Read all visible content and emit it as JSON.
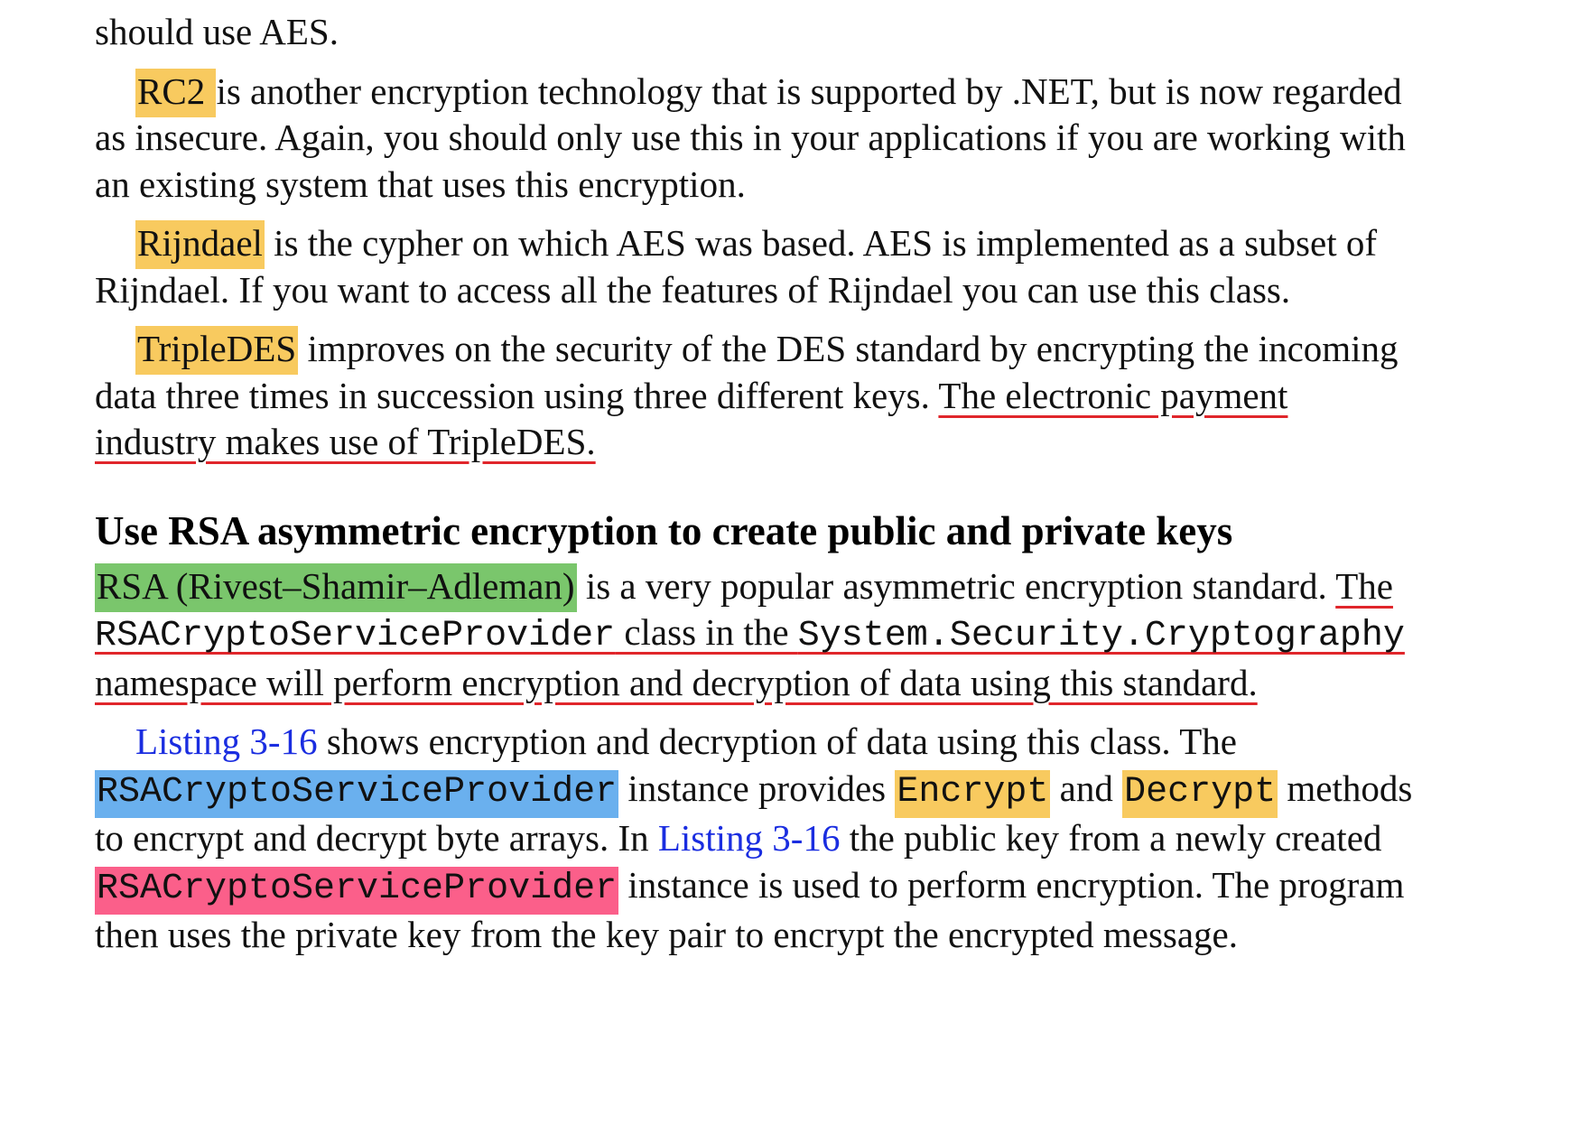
{
  "document": {
    "intro_fragment": "should use AES.",
    "paragraphs": {
      "rc2": {
        "term": "RC2 ",
        "text": "is another encryption technology that is supported by .NET, but is now regarded as insecure. Again, you should only use this in your applications if you are working with an existing system that uses this encryption."
      },
      "rijndael": {
        "term": "Rijndael",
        "text": " is the cypher on which AES was based. AES is implemented as a subset of Rijndael. If you want to access all the features of Rijndael you can use this class."
      },
      "tripledes": {
        "term": "TripleDES",
        "text_plain": " improves on the security of the DES standard by encrypting the incoming data three times in succession using three different keys. ",
        "text_underlined": "The electronic payment industry makes use of TripleDES."
      }
    },
    "section": {
      "heading": "Use RSA asymmetric encryption to create public and private keys",
      "rsa_para": {
        "term": "RSA (Rivest–Shamir–Adleman)",
        "text_plain": " is a very popular asymmetric encryption standard. ",
        "ul_text_1": "The ",
        "ul_code_1": "RSACryptoServiceProvider",
        "ul_text_2": " class in the ",
        "ul_code_2": "System.Security.Cryptography",
        "ul_text_3": " namespace will perform encryption and decryption of data using this standard."
      },
      "listing_para": {
        "link_1": "Listing 3-16",
        "text_1": " shows encryption and decryption of data using this class. The ",
        "code_blue": "RSACryptoServiceProvider",
        "text_2": " instance provides ",
        "code_encrypt": "Encrypt",
        "text_3": " and ",
        "code_decrypt": "Decrypt",
        "text_4": " methods to encrypt and decrypt byte arrays. In ",
        "link_2": "Listing 3-16",
        "text_5": " the public key from a newly created ",
        "code_pink": "RSACryptoServiceProvider",
        "text_6": " instance is used to perform encryption. The program then uses the private key from the key pair to encrypt the encrypted message."
      }
    }
  },
  "colors": {
    "highlight_yellow": "#f8ca5f",
    "highlight_green": "#7ac66c",
    "highlight_blue": "#6ab0ee",
    "highlight_pink": "#fb5f8a",
    "underline_red": "#e0262b",
    "link_blue": "#1a2de0"
  }
}
